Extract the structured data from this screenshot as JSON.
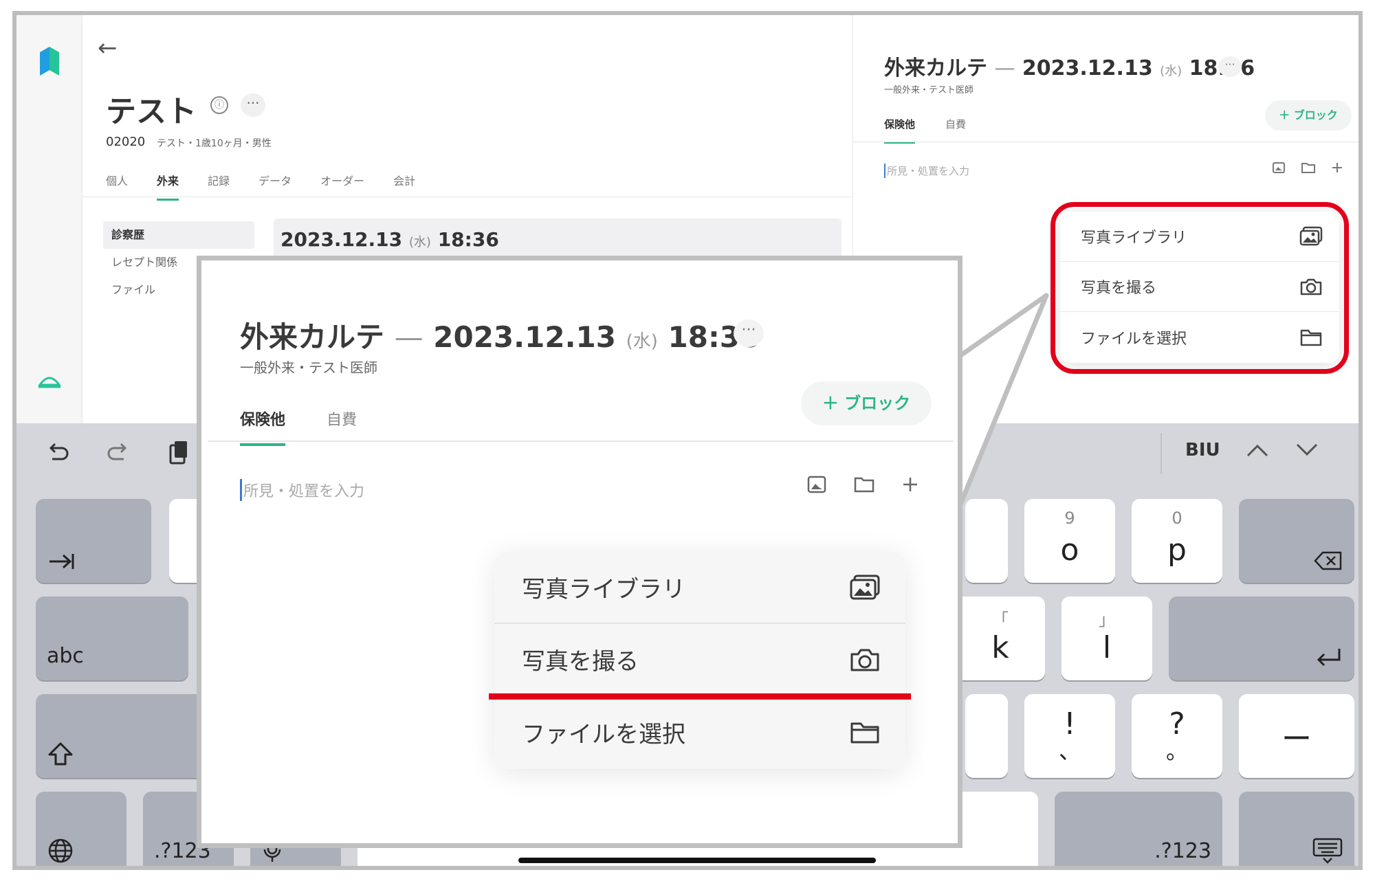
{
  "app": {
    "patient": {
      "name": "テスト",
      "id": "02020",
      "meta": "テスト・1歳10ヶ月・男性",
      "info_chip": "ⓘ",
      "more": "···"
    },
    "tabs": [
      "個人",
      "外来",
      "記録",
      "データ",
      "オーダー",
      "会計"
    ],
    "active_tab": "外来",
    "side_menu": [
      "診察歴",
      "レセプト関係",
      "ファイル"
    ],
    "visit_date": "2023.12.13",
    "visit_day": "(水)",
    "visit_time": "18:36"
  },
  "right_panel": {
    "title": "外来カルテ",
    "dash": "—",
    "date": "2023.12.13",
    "day": "(水)",
    "time": "18:36",
    "more": "···",
    "subtitle": "一般外来・テスト医師",
    "tabs": [
      "保険他",
      "自費"
    ],
    "block_button": "＋ ブロック",
    "input_placeholder": "所見・処置を入力",
    "menu": [
      "写真ライブラリ",
      "写真を撮る",
      "ファイルを選択"
    ]
  },
  "keyboard": {
    "toolbar": {
      "biu": "BIU"
    },
    "keys": {
      "o": "o",
      "o_sub": "9",
      "p": "p",
      "p_sub": "0",
      "k": "k",
      "k_sub": "「",
      "l": "l",
      "l_sub": "」",
      "excl": "!",
      "excl_sub": "、",
      "q": "?",
      "q_sub": "。",
      "dash": "ー",
      "abc": "abc",
      "num_left": ".?123",
      "num_right": ".?123"
    }
  },
  "colors": {
    "accent": "#2cb58a",
    "highlight": "#e3001b"
  }
}
